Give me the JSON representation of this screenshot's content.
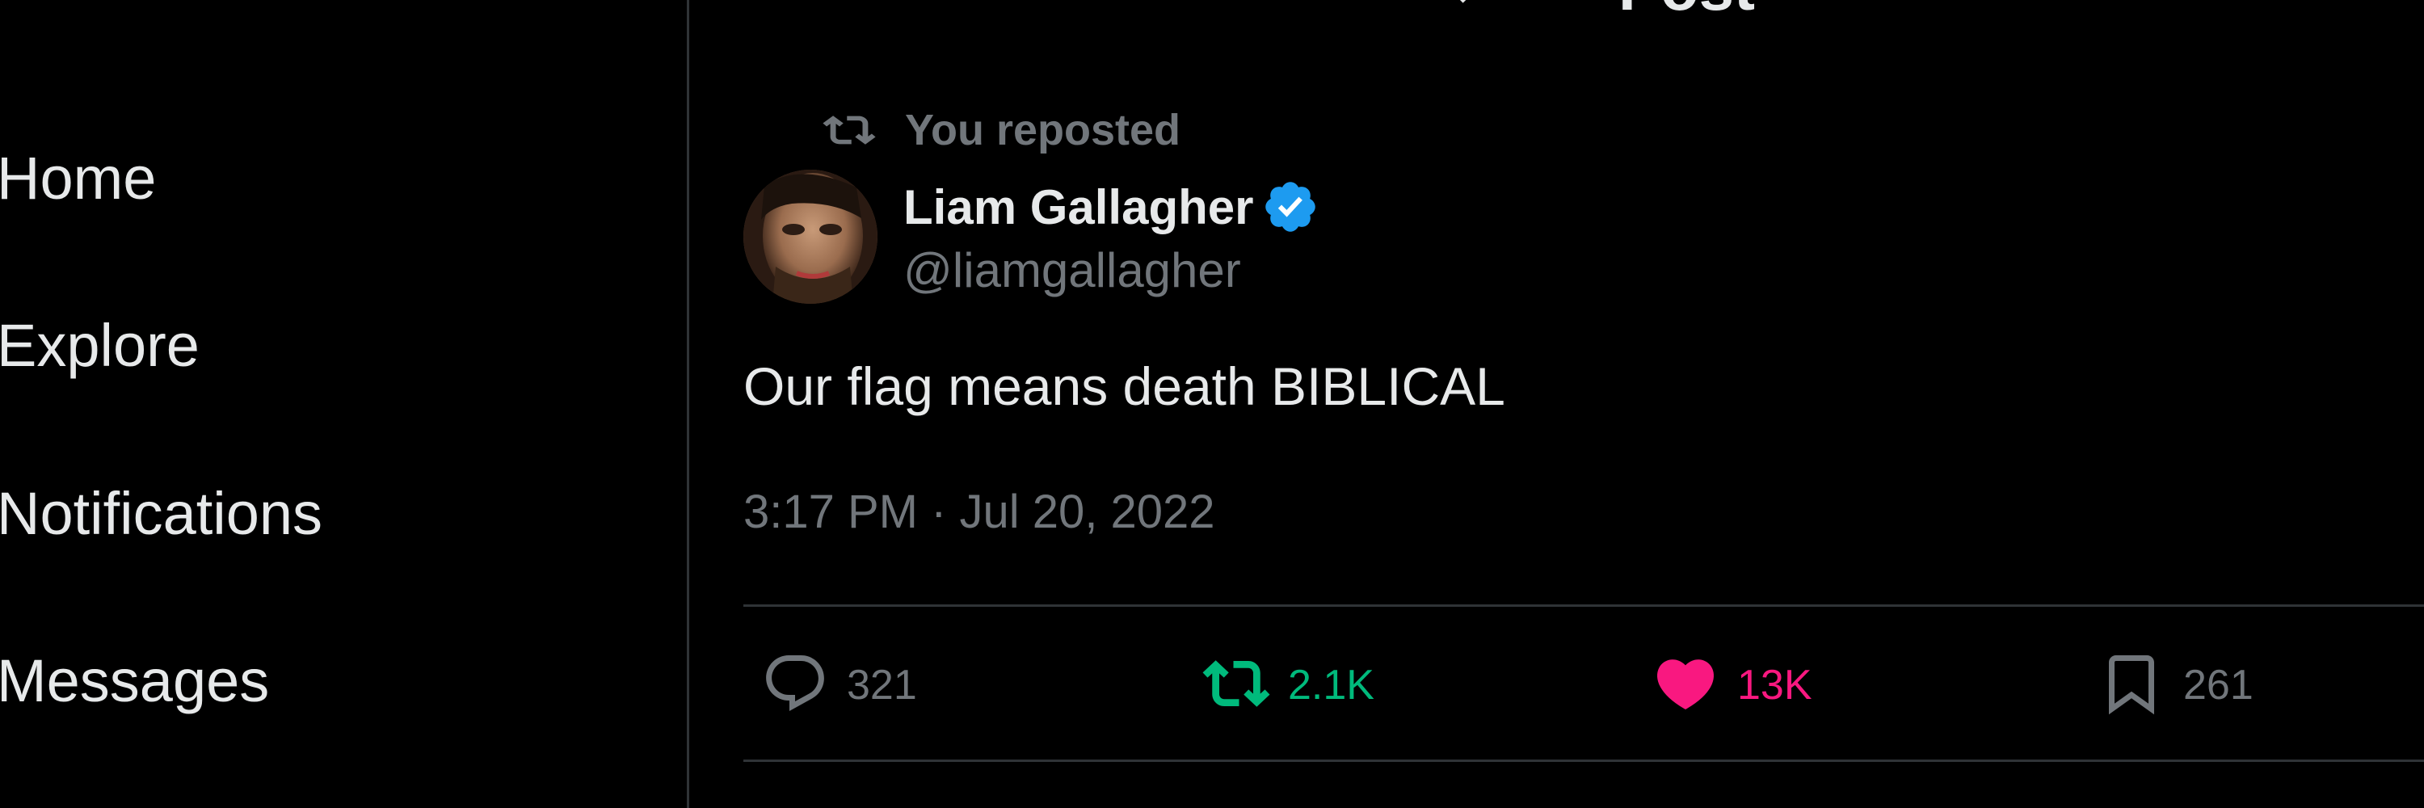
{
  "colors": {
    "background": "#000000",
    "text_primary": "#e7e9ea",
    "text_secondary": "#71767b",
    "border": "#2f3336",
    "verified_blue": "#1d9bf0",
    "repost_green": "#00ba7c",
    "like_pink": "#f91880"
  },
  "sidebar": {
    "items": [
      {
        "label": "Home"
      },
      {
        "label": "Explore"
      },
      {
        "label": "Notifications"
      },
      {
        "label": "Messages"
      }
    ]
  },
  "header": {
    "title": "Post",
    "back_icon": "arrow-left-icon"
  },
  "post": {
    "context_label": "You reposted",
    "context_icon": "repost-icon",
    "author": {
      "name": "Liam Gallagher",
      "handle": "@liamgallagher",
      "verified": true,
      "verified_icon": "verified-badge-icon"
    },
    "text": "Our flag means death BIBLICAL",
    "timestamp": "3:17 PM · Jul 20, 2022",
    "actions": {
      "replies": {
        "icon": "reply-icon",
        "count": "321"
      },
      "reposts": {
        "icon": "repost-icon",
        "count": "2.1K",
        "active": true
      },
      "likes": {
        "icon": "heart-icon",
        "count": "13K",
        "active": true
      },
      "bookmarks": {
        "icon": "bookmark-icon",
        "count": "261"
      }
    }
  }
}
